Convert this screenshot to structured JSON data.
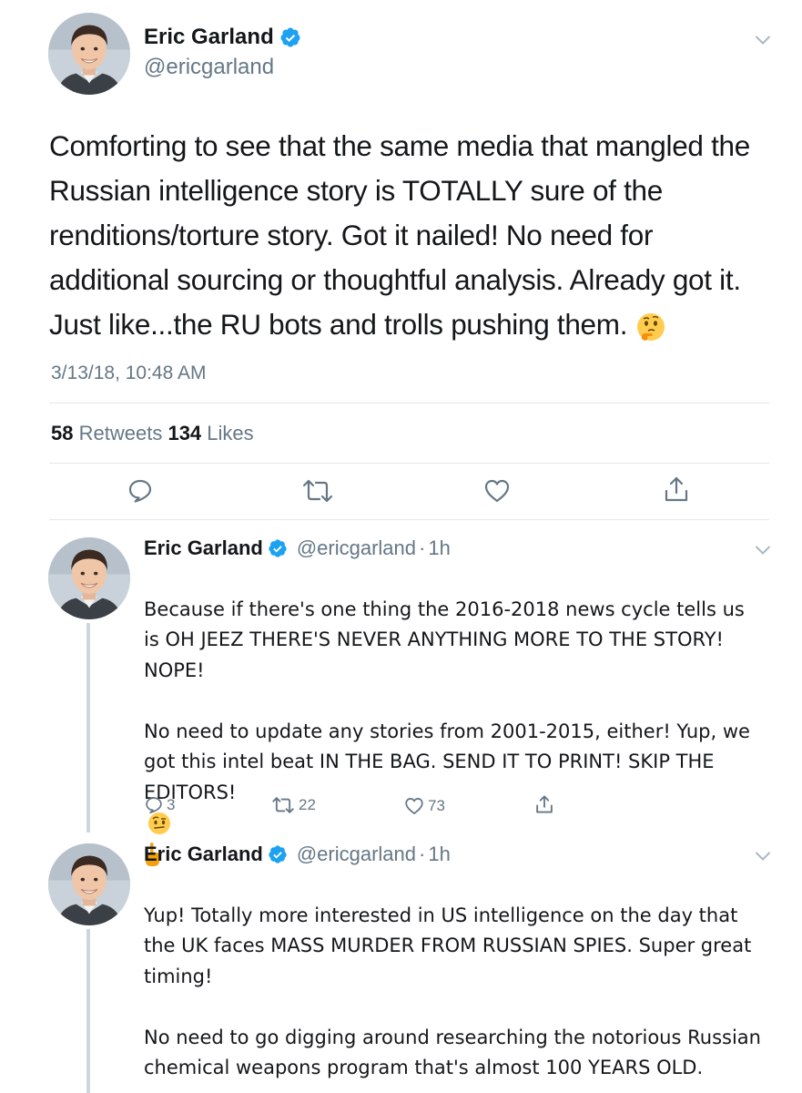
{
  "colors": {
    "text": "#14171a",
    "secondary": "#657786",
    "verified": "#1da1f2",
    "divider": "#e1e8ed",
    "thread_line": "#ccd6dd"
  },
  "main_tweet": {
    "author_name": "Eric Garland",
    "handle": "@ericgarland",
    "text": "Comforting to see that the same media that mangled the Russian intelligence story is TOTALLY sure of the renditions/torture story. Got it nailed! No need for additional sourcing or thoughtful analysis. Already got it. Just like...the RU bots and trolls pushing them.",
    "emoji": "thinking-face",
    "timestamp": "3/13/18, 10:48 AM",
    "retweets_count": "58",
    "retweets_label": "Retweets",
    "likes_count": "134",
    "likes_label": "Likes",
    "actions": [
      "reply-icon",
      "retweet-icon",
      "heart-icon",
      "share-icon"
    ]
  },
  "replies": [
    {
      "author_name": "Eric Garland",
      "handle": "@ericgarland",
      "separator": "·",
      "age": "1h",
      "text": "Because if there's one thing the 2016-2018 news cycle tells us is OH JEEZ THERE'S NEVER ANYTHING MORE TO THE STORY! NOPE!\n\nNo need to update any stories from 2001-2015, either! Yup, we got this intel beat IN THE BAG. SEND IT TO PRINT! SKIP THE EDITORS!",
      "emojis": [
        "face-with-raised-eyebrow",
        "pointing-up-hand"
      ],
      "reply_count": "3",
      "retweet_count": "22",
      "like_count": "73"
    },
    {
      "author_name": "Eric Garland",
      "handle": "@ericgarland",
      "separator": "·",
      "age": "1h",
      "text": "Yup! Totally more interested in US intelligence on the day that the UK faces MASS MURDER FROM RUSSIAN SPIES. Super great timing!\n\nNo need to go digging around researching the notorious Russian chemical weapons program that's almost 100 YEARS OLD."
    }
  ]
}
